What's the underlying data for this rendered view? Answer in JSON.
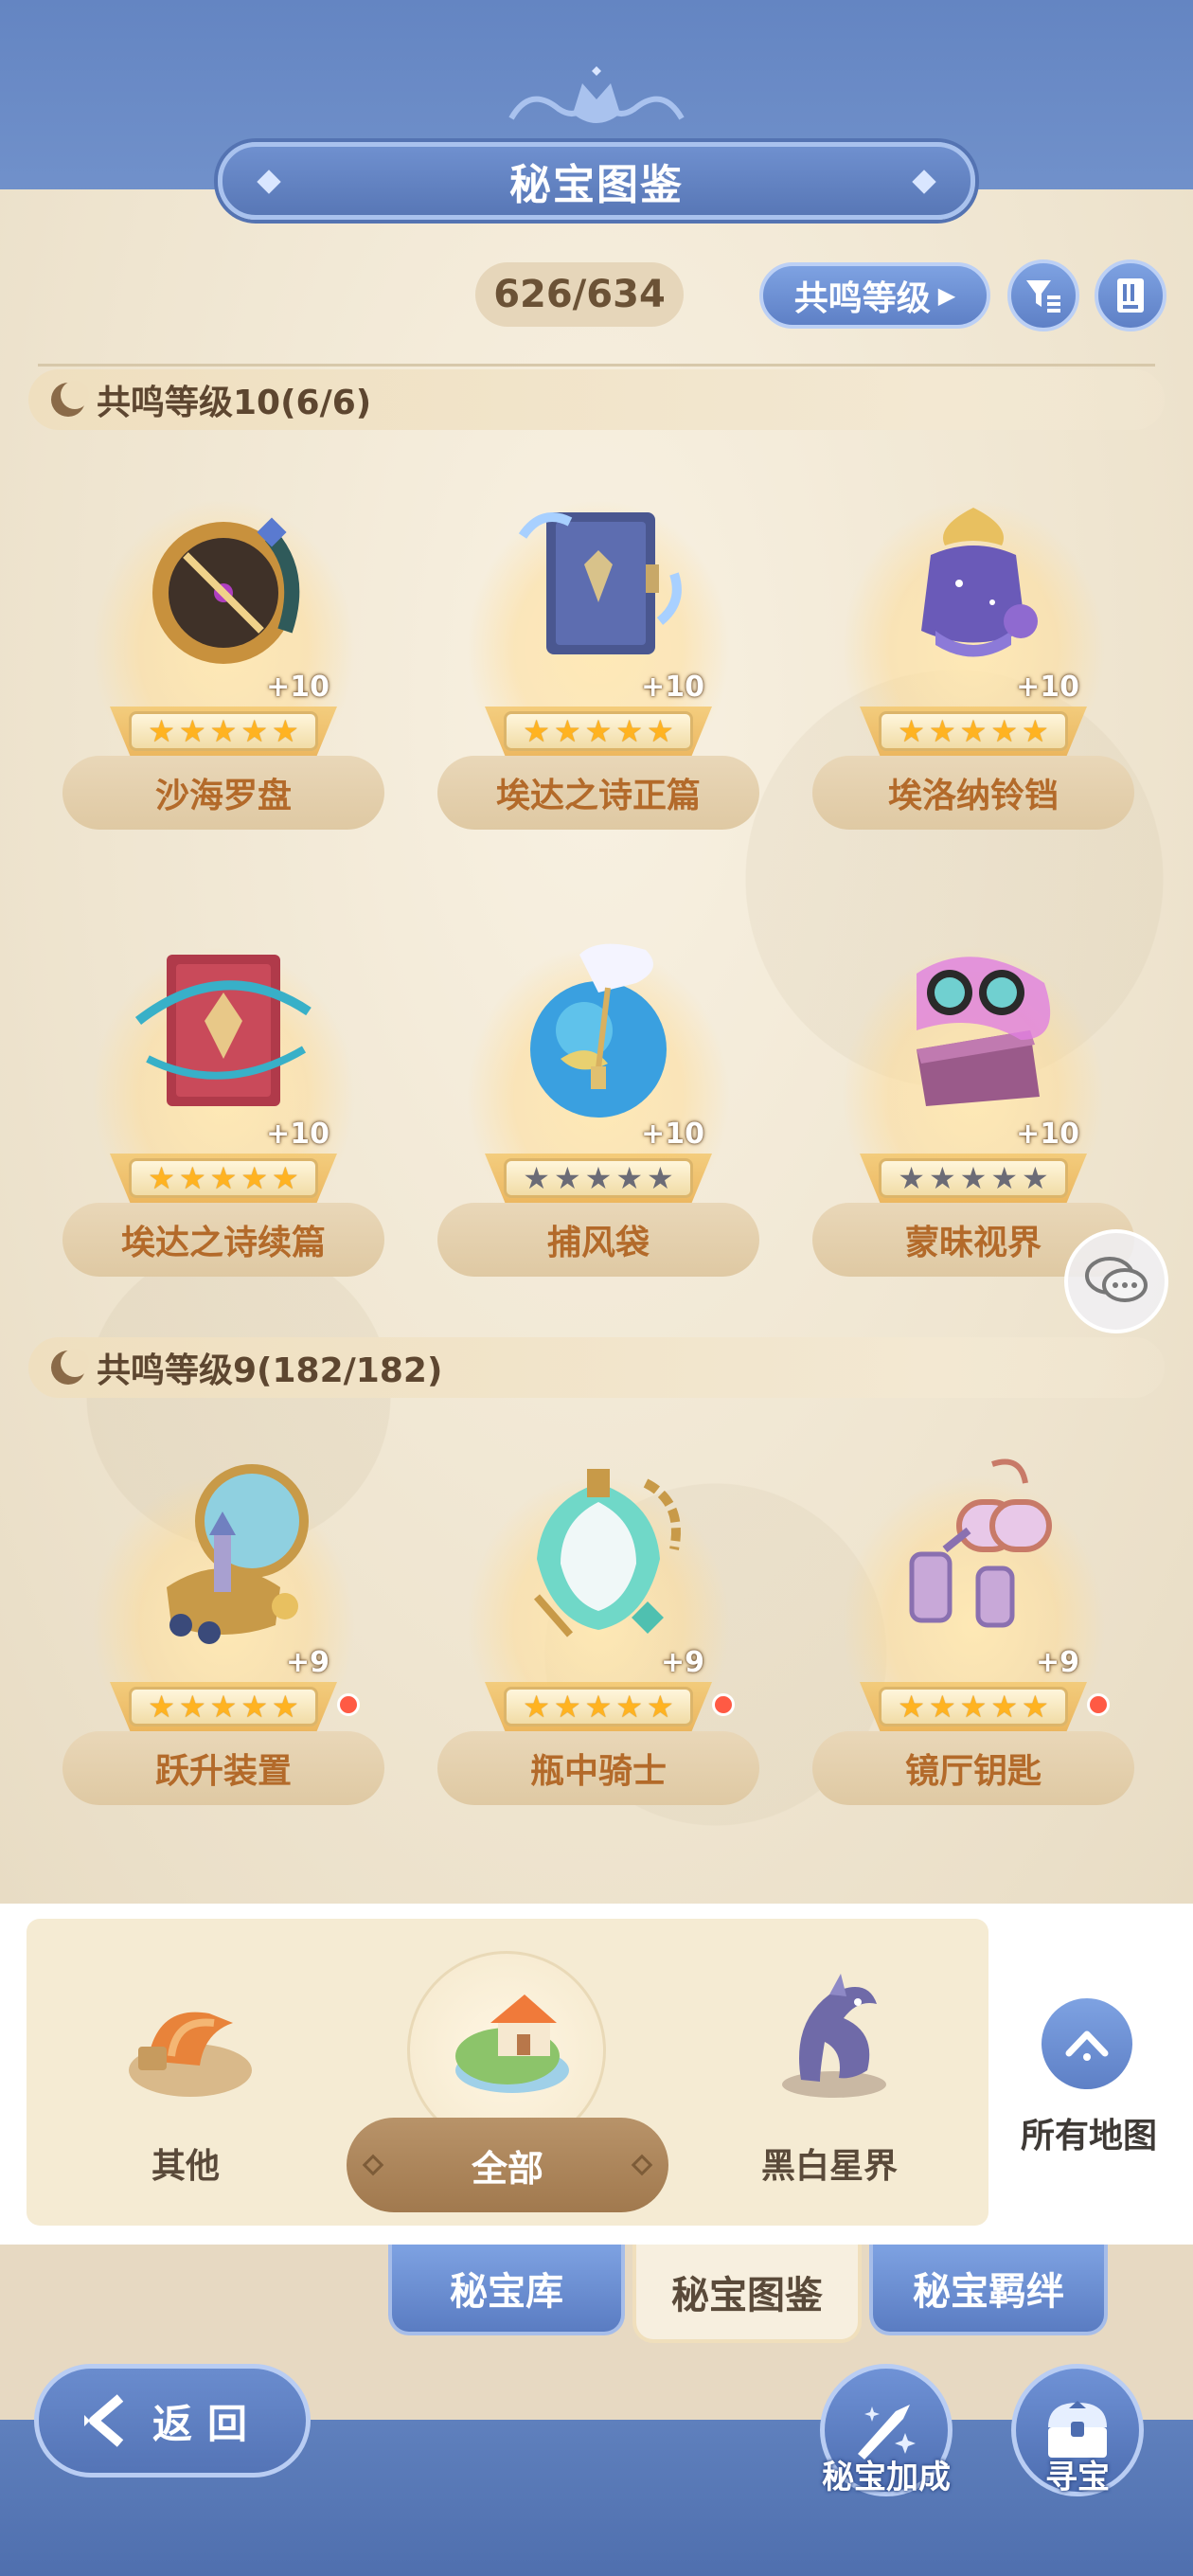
{
  "header": {
    "title": "秘宝图鉴"
  },
  "toolbar": {
    "count": "626/634",
    "sort_label": "共鸣等级",
    "sort_arrow": "▶",
    "filter_icon": "filter-icon",
    "book_icon": "book-icon"
  },
  "sections": [
    {
      "label": "共鸣等级10(6/6)",
      "items": [
        {
          "name": "沙海罗盘",
          "plus": "+10",
          "stars_filled": 5,
          "stars_total": 5,
          "red_dot": false
        },
        {
          "name": "埃达之诗正篇",
          "plus": "+10",
          "stars_filled": 5,
          "stars_total": 5,
          "red_dot": false
        },
        {
          "name": "埃洛纳铃铛",
          "plus": "+10",
          "stars_filled": 5,
          "stars_total": 5,
          "red_dot": false
        },
        {
          "name": "埃达之诗续篇",
          "plus": "+10",
          "stars_filled": 5,
          "stars_total": 5,
          "red_dot": false
        },
        {
          "name": "捕风袋",
          "plus": "+10",
          "stars_filled": 0,
          "stars_total": 5,
          "red_dot": false
        },
        {
          "name": "蒙昧视界",
          "plus": "+10",
          "stars_filled": 0,
          "stars_total": 5,
          "red_dot": false
        }
      ]
    },
    {
      "label": "共鸣等级9(182/182)",
      "items": [
        {
          "name": "跃升装置",
          "plus": "+9",
          "stars_filled": 5,
          "stars_total": 5,
          "red_dot": true
        },
        {
          "name": "瓶中骑士",
          "plus": "+9",
          "stars_filled": 5,
          "stars_total": 5,
          "red_dot": true
        },
        {
          "name": "镜厅钥匙",
          "plus": "+9",
          "stars_filled": 5,
          "stars_total": 5,
          "red_dot": true
        }
      ]
    }
  ],
  "map_filter": {
    "items": [
      {
        "label": "其他",
        "icon": "desert-ribbon-icon"
      },
      {
        "label": "全部",
        "icon": "house-island-icon",
        "selected": true
      },
      {
        "label": "黑白星界",
        "icon": "dragon-icon"
      }
    ],
    "all_maps_label": "所有地图"
  },
  "tabs": [
    {
      "label": "秘宝库",
      "active": false
    },
    {
      "label": "秘宝图鉴",
      "active": true
    },
    {
      "label": "秘宝羁绊",
      "active": false
    }
  ],
  "footer": {
    "back_label": "返回",
    "bonus_label": "秘宝加成",
    "treasure_label": "寻宝"
  },
  "colors": {
    "accent_blue": "#5f80bd",
    "name_text": "#b36a2a",
    "star_on": "#ffb321",
    "star_off": "#6b6b76",
    "badge_red": "#ff5a44"
  }
}
